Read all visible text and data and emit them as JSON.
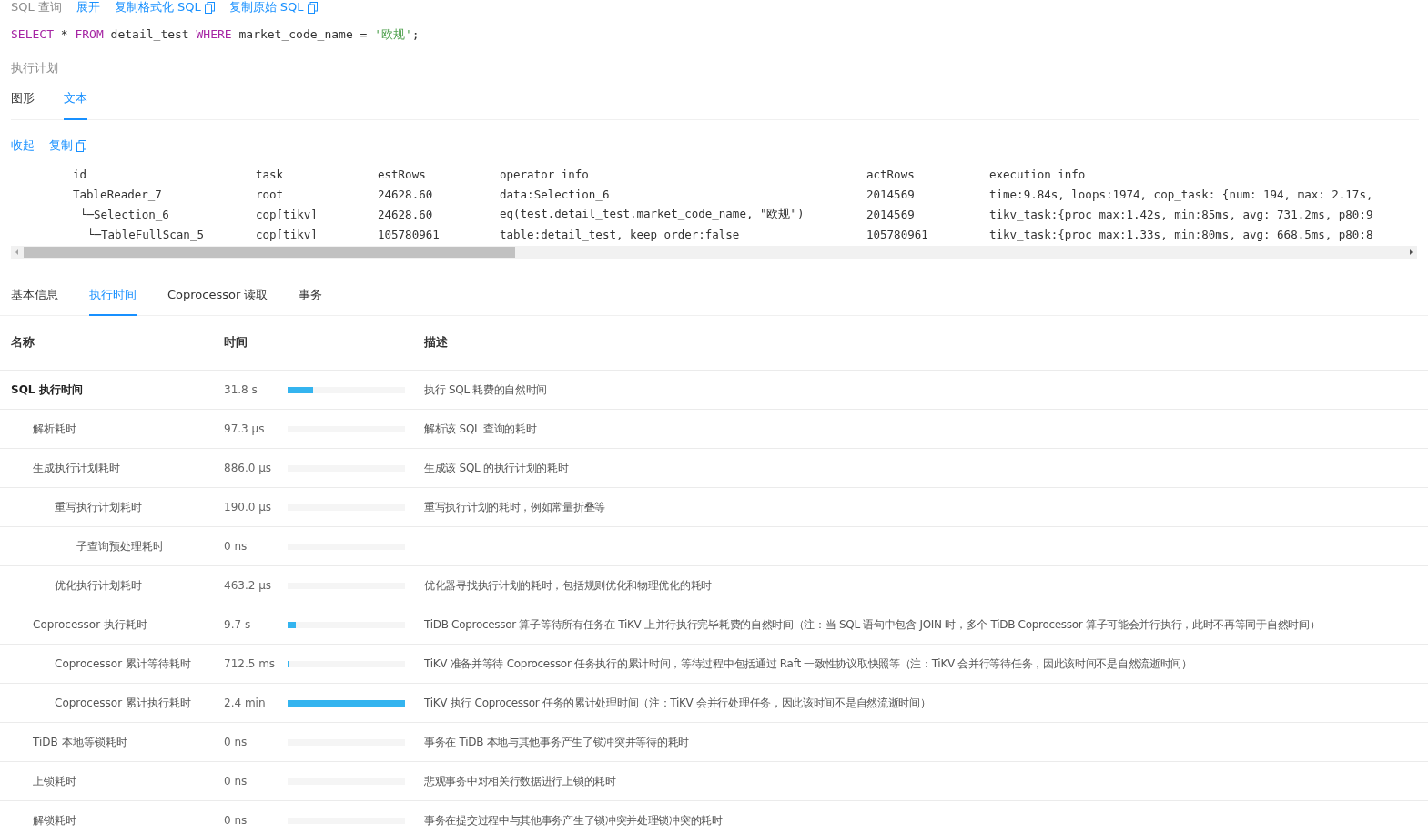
{
  "sql_section": {
    "title": "SQL 查询",
    "links": [
      {
        "label": "展开",
        "icon": false
      },
      {
        "label": "复制格式化 SQL",
        "icon": true
      },
      {
        "label": "复制原始 SQL",
        "icon": true
      }
    ],
    "query": [
      {
        "kind": "keyword",
        "text": "SELECT"
      },
      {
        "kind": "plain",
        "text": " * "
      },
      {
        "kind": "keyword",
        "text": "FROM"
      },
      {
        "kind": "plain",
        "text": " detail_test "
      },
      {
        "kind": "keyword",
        "text": "WHERE"
      },
      {
        "kind": "plain",
        "text": " market_code_name = "
      },
      {
        "kind": "string",
        "text": "'欧规'"
      },
      {
        "kind": "plain",
        "text": ";"
      }
    ]
  },
  "plan_section": {
    "title": "执行计划",
    "tabs": [
      {
        "label": "图形",
        "selected": false
      },
      {
        "label": "文本",
        "selected": true
      }
    ],
    "links": [
      {
        "label": "收起",
        "icon": false
      },
      {
        "label": "复制",
        "icon": true
      }
    ],
    "columns": [
      "id",
      "task",
      "estRows",
      "operator info",
      "actRows",
      "execution info"
    ],
    "rows": [
      {
        "id": "TableReader_7",
        "task": "root",
        "estRows": "24628.60",
        "operator_info": "data:Selection_6",
        "actRows": "2014569",
        "execution_info": "time:9.84s, loops:1974, cop_task: {num: 194, max: 2.17s,",
        "children": [
          {
            "id": "└─Selection_6",
            "task": "cop[tikv]",
            "estRows": "24628.60",
            "operator_info": "eq(test.detail_test.market_code_name, \"欧规\")",
            "actRows": "2014569",
            "execution_info": "tikv_task:{proc max:1.42s, min:85ms, avg: 731.2ms, p80:9",
            "children": [
              {
                "id": "└─TableFullScan_5",
                "task": "cop[tikv]",
                "estRows": "105780961",
                "operator_info": "table:detail_test, keep order:false",
                "actRows": "105780961",
                "execution_info": "tikv_task:{proc max:1.33s, min:80ms, avg: 668.5ms, p80:8"
              }
            ]
          }
        ]
      }
    ]
  },
  "detail_tabs": [
    {
      "label": "基本信息",
      "selected": false
    },
    {
      "label": "执行时间",
      "selected": true
    },
    {
      "label": "Coprocessor 读取",
      "selected": false
    },
    {
      "label": "事务",
      "selected": false
    }
  ],
  "time_table": {
    "columns": [
      "名称",
      "时间",
      "描述"
    ],
    "rows": [
      {
        "name": "SQL 执行时间",
        "time": "31.8 s",
        "level": 0.22,
        "description": "执行 SQL 耗费的自然时间",
        "children": [
          {
            "name": "解析耗时",
            "time": "97.3 µs",
            "description": "解析该 SQL 查询的耗时"
          },
          {
            "name": "生成执行计划耗时",
            "time": "886.0 µs",
            "description": "生成该 SQL 的执行计划的耗时",
            "children": [
              {
                "name": "重写执行计划耗时",
                "time": "190.0 µs",
                "description": "重写执行计划的耗时，例如常量折叠等",
                "children": [
                  {
                    "name": "子查询预处理耗时",
                    "time": "0 ns"
                  }
                ]
              },
              {
                "name": "优化执行计划耗时",
                "time": "463.2 µs",
                "description": "优化器寻找执行计划的耗时，包括规则优化和物理优化的耗时"
              }
            ]
          },
          {
            "name": "Coprocessor 执行耗时",
            "time": "9.7 s",
            "level": 0.067,
            "description": "TiDB Coprocessor 算子等待所有任务在 TiKV 上并行执行完毕耗费的自然时间（注：当 SQL 语句中包含 JOIN 时，多个 TiDB Coprocessor 算子可能会并行执行，此时不再等同于自然时间）",
            "children": [
              {
                "name": "Coprocessor 累计等待耗时",
                "time": "712.5 ms",
                "level": 0.006,
                "description": "TiKV 准备并等待 Coprocessor 任务执行的累计时间，等待过程中包括通过 Raft 一致性协议取快照等（注：TiKV 会并行等待任务，因此该时间不是自然流逝时间）"
              },
              {
                "name": "Coprocessor 累计执行耗时",
                "time": "2.4 min",
                "level": 1,
                "description": "TiKV 执行 Coprocessor 任务的累计处理时间（注：TiKV 会并行处理任务，因此该时间不是自然流逝时间）"
              }
            ]
          },
          {
            "name": "TiDB 本地等锁耗时",
            "time": "0 ns",
            "description": "事务在 TiDB 本地与其他事务产生了锁冲突并等待的耗时"
          },
          {
            "name": "上锁耗时",
            "time": "0 ns",
            "description": "悲观事务中对相关行数据进行上锁的耗时"
          },
          {
            "name": "解锁耗时",
            "time": "0 ns",
            "description": "事务在提交过程中与其他事务产生了锁冲突并处理锁冲突的耗时"
          }
        ]
      }
    ]
  }
}
